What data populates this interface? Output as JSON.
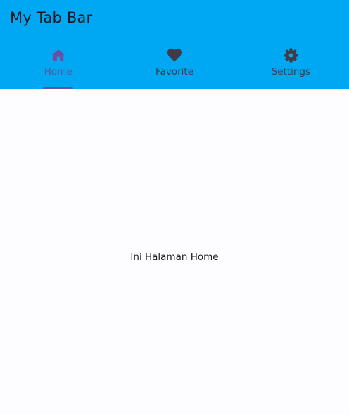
{
  "appbar": {
    "title": "My Tab Bar",
    "background": "#00a8f3"
  },
  "tabs": [
    {
      "label": "Home",
      "icon": "home-icon",
      "active": true
    },
    {
      "label": "Favorite",
      "icon": "heart-icon",
      "active": false
    },
    {
      "label": "Settings",
      "icon": "gear-icon",
      "active": false
    }
  ],
  "colors": {
    "active_tab": "#6a4ea0",
    "inactive_tab": "#3f3c47"
  },
  "content": {
    "text": "Ini Halaman Home"
  }
}
